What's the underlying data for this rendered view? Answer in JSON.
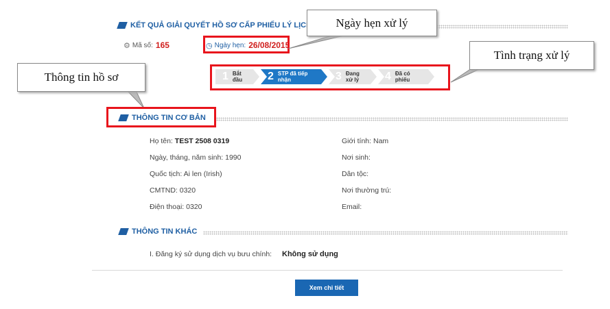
{
  "header": {
    "title": "KẾT QUẢ GIẢI QUYẾT HỒ SƠ CẤP PHIẾU LÝ LỊCH",
    "code_label": "Mã số:",
    "code_value": "165",
    "appointment_label": "Ngày hẹn:",
    "appointment_value": "26/08/2015"
  },
  "steps": [
    {
      "num": "1",
      "label": "Bắt đầu",
      "active": false
    },
    {
      "num": "2",
      "label": "STP đã tiếp nhận",
      "active": true
    },
    {
      "num": "3",
      "label": "Đang xử lý",
      "active": false
    },
    {
      "num": "4",
      "label": "Đã có phiếu",
      "active": false
    }
  ],
  "basic_info": {
    "title": "THÔNG TIN CƠ BẢN",
    "name_label": "Họ tên:",
    "name_value": "TEST 2508 0319",
    "dob": "Ngày, tháng, năm sinh: 1990",
    "nationality": "Quốc tịch: Ai len (Irish)",
    "id_card": "CMTND: 0320",
    "phone": "Điện thoại: 0320",
    "gender": "Giới tính: Nam",
    "birthplace": "Nơi sinh:",
    "ethnicity": "Dân tộc:",
    "residence": "Nơi thường trú:",
    "email": "Email:"
  },
  "other_info": {
    "title": "THÔNG TIN KHÁC",
    "postal_label": "I. Đăng ký sử dụng dịch vụ bưu chính:",
    "postal_value": "Không sử dụng"
  },
  "details_button": "Xem chi tiết",
  "callouts": {
    "appointment": "Ngày hẹn xử lý",
    "status": "Tình trạng xử lý",
    "profile": "Thông tin hồ sơ"
  },
  "colors": {
    "accent": "#1f5fa3",
    "highlight": "#e8141c",
    "active_step": "#1f78c6"
  }
}
